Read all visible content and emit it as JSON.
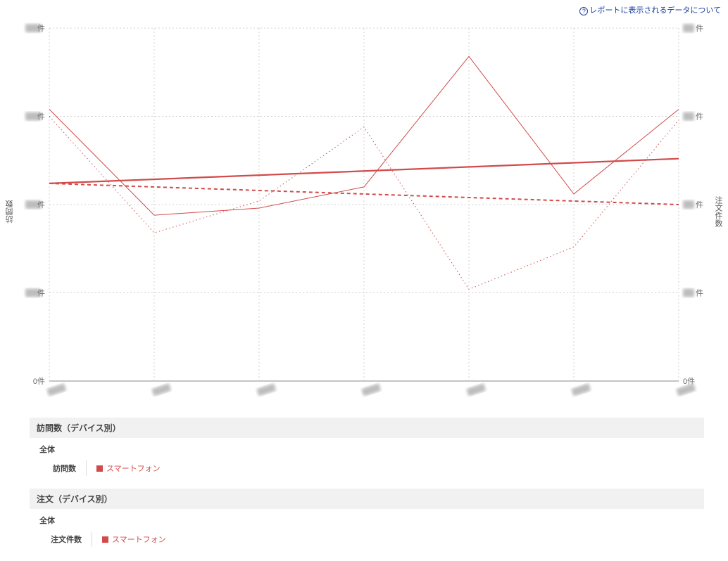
{
  "top_link": {
    "text": "レポートに表示されるデータについて"
  },
  "chart_data": {
    "type": "line",
    "title": "",
    "x": [
      0,
      1,
      2,
      3,
      4,
      5,
      6
    ],
    "x_tick_display": [
      "(blurred)",
      "(blurred)",
      "(blurred)",
      "(blurred)",
      "(blurred)",
      "(blurred)",
      "(blurred)"
    ],
    "left_axis": {
      "label": "訪問数",
      "unit_suffix": "件",
      "tick_display": [
        "(blurred)件",
        "(blurred)件",
        "(blurred)件",
        "(blurred)件",
        "0件"
      ],
      "range_fraction": [
        1.0,
        0.75,
        0.5,
        0.25,
        0.0
      ]
    },
    "right_axis": {
      "label": "注文件数",
      "unit_suffix": "件",
      "tick_display": [
        "(blurred)件",
        "(blurred)件",
        "(blurred)件",
        "(blurred)件",
        "0件"
      ],
      "range_fraction": [
        1.0,
        0.75,
        0.5,
        0.25,
        0.0
      ]
    },
    "series": [
      {
        "name": "訪問数 スマートフォン",
        "style": "solid-thin",
        "axis": "left",
        "values_fraction": [
          0.77,
          0.47,
          0.49,
          0.55,
          0.92,
          0.53,
          0.77
        ]
      },
      {
        "name": "訪問数 スマートフォン トレンド",
        "style": "solid-thick",
        "axis": "left",
        "is_trend": true,
        "values_fraction": [
          0.56,
          null,
          null,
          null,
          null,
          null,
          0.63
        ]
      },
      {
        "name": "注文件数 スマートフォン",
        "style": "dotted-thin",
        "axis": "right",
        "values_fraction": [
          0.75,
          0.42,
          0.51,
          0.72,
          0.26,
          0.38,
          0.74
        ]
      },
      {
        "name": "注文件数 スマートフォン トレンド",
        "style": "dashed-thick",
        "axis": "right",
        "is_trend": true,
        "values_fraction": [
          0.56,
          null,
          null,
          null,
          null,
          null,
          0.5
        ]
      }
    ],
    "note": "All numeric axis tick values and x-axis category labels are blurred/redacted in the source image; series values are provided as fractions of the visible y-range as read from pixel positions."
  },
  "sections": [
    {
      "header": "訪問数（デバイス別）",
      "sub": "全体",
      "legend_label": "訪問数",
      "legend_item": "スマートフォン"
    },
    {
      "header": "注文（デバイス別）",
      "sub": "全体",
      "legend_label": "注文件数",
      "legend_item": "スマートフォン"
    }
  ]
}
